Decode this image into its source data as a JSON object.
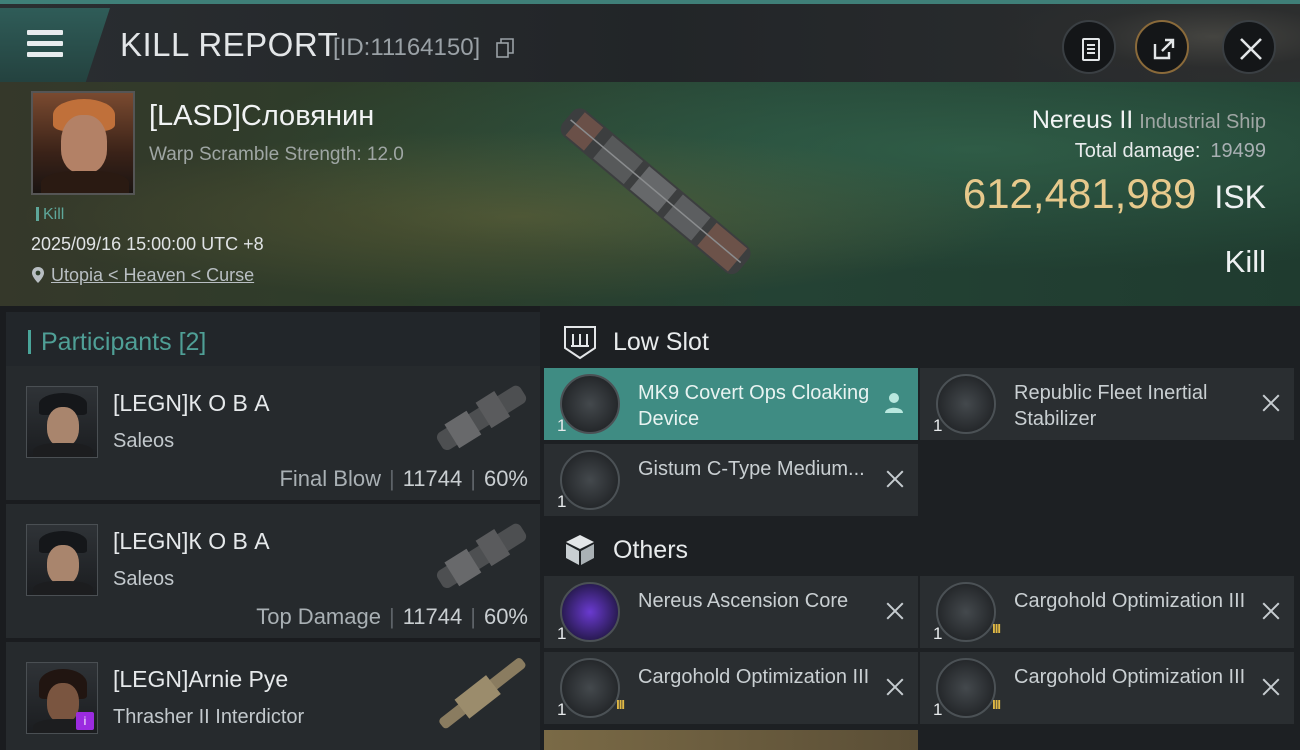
{
  "header": {
    "title": "KILL REPORT",
    "kill_id": "[ID:11164150]",
    "icons": [
      "menu-icon",
      "copy-icon",
      "clipboard-icon",
      "share-icon",
      "close-icon"
    ]
  },
  "victim": {
    "name": "[LASD]Словянин",
    "warp_scramble": "Warp Scramble Strength: 12.0",
    "tag": "Kill",
    "datetime": "2025/09/16 15:00:00 UTC +8",
    "location": "Utopia < Heaven < Curse",
    "ship_name": "Nereus II",
    "ship_class": "Industrial Ship",
    "total_damage_label": "Total damage:",
    "total_damage": "19499",
    "isk_value": "612,481,989",
    "isk_currency": "ISK",
    "result": "Kill"
  },
  "participants": {
    "label": "Participants",
    "count": "[2]",
    "rows": [
      {
        "name": "[LEGN]К О В А",
        "ship": "Saleos",
        "role": "Final Blow",
        "damage": "11744",
        "percent": "60%"
      },
      {
        "name": "[LEGN]К О В А",
        "ship": "Saleos",
        "role": "Top Damage",
        "damage": "11744",
        "percent": "60%"
      },
      {
        "name": "[LEGN]Arnie Pye",
        "ship": "Thrasher II Interdictor",
        "role": "",
        "damage": "",
        "percent": ""
      }
    ]
  },
  "low_slot": {
    "label": "Low Slot",
    "items": [
      {
        "name": "MK9 Covert Ops Cloaking Device",
        "qty": "1",
        "status": "dropped"
      },
      {
        "name": "Republic Fleet Inertial Stabilizer",
        "qty": "1",
        "status": "destroyed"
      },
      {
        "name": "Gistum C-Type Medium...",
        "qty": "1",
        "status": "destroyed"
      }
    ]
  },
  "others": {
    "label": "Others",
    "items": [
      {
        "name": "Nereus Ascension Core",
        "qty": "1",
        "status": "destroyed"
      },
      {
        "name": "Cargohold Optimization III",
        "qty": "1",
        "status": "destroyed",
        "badge": "III"
      },
      {
        "name": "Cargohold Optimization III",
        "qty": "1",
        "status": "destroyed",
        "badge": "III"
      },
      {
        "name": "Cargohold Optimization III",
        "qty": "1",
        "status": "destroyed",
        "badge": "III"
      }
    ]
  },
  "colors": {
    "accent": "#3f8c83",
    "isk": "#e7c98c",
    "participant_label": "#4f9f96",
    "drone_badge": "#9b2be0"
  }
}
